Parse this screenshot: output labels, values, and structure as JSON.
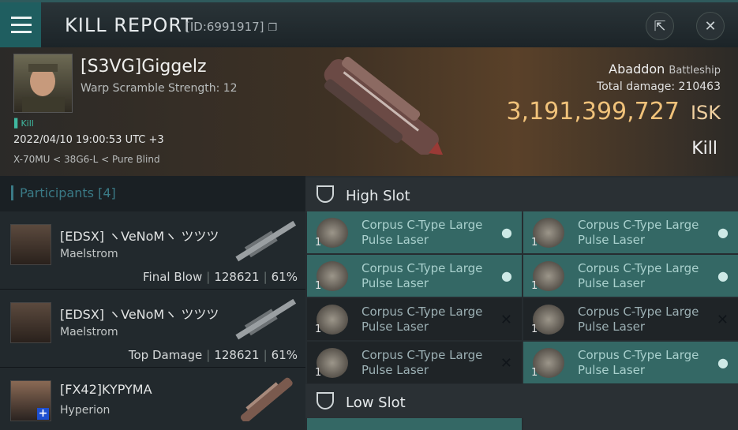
{
  "window": {
    "title": "KILL REPORT",
    "report_id": "[ID:6991917]"
  },
  "victim": {
    "name": "[S3VG]Giggelz",
    "warp_scramble": "Warp Scramble Strength: 12",
    "kill_tag": "Kill",
    "datetime": "2022/04/10 19:00:53 UTC +3",
    "location": "X-70MU < 38G6-L < Pure Blind",
    "ship_name": "Abaddon",
    "ship_class": "Battleship",
    "total_damage_label": "Total damage:",
    "total_damage": "210463",
    "isk_value": "3,191,399,727",
    "isk_unit": "ISK",
    "result": "Kill"
  },
  "participants": {
    "label": "Participants",
    "count": "[4]",
    "rows": [
      {
        "name": "[EDSX] ヽVeNoMヽ ツツツ",
        "ship": "Maelstrom",
        "role": "Final Blow",
        "damage": "128621",
        "percent": "61%"
      },
      {
        "name": "[EDSX] ヽVeNoMヽ ツツツ",
        "ship": "Maelstrom",
        "role": "Top Damage",
        "damage": "128621",
        "percent": "61%"
      },
      {
        "name": "[FX42]KYPYMA",
        "ship": "Hyperion",
        "role": "",
        "damage": "",
        "percent": ""
      }
    ]
  },
  "slots": {
    "high": {
      "label": "High Slot",
      "modules": [
        {
          "name": "Corpus C-Type Large Pulse Laser",
          "qty": "1",
          "status": "fitted"
        },
        {
          "name": "Corpus C-Type Large Pulse Laser",
          "qty": "1",
          "status": "fitted"
        },
        {
          "name": "Corpus C-Type Large Pulse Laser",
          "qty": "1",
          "status": "fitted"
        },
        {
          "name": "Corpus C-Type Large Pulse Laser",
          "qty": "1",
          "status": "fitted"
        },
        {
          "name": "Corpus C-Type Large Pulse Laser",
          "qty": "1",
          "status": "destroyed"
        },
        {
          "name": "Corpus C-Type Large Pulse Laser",
          "qty": "1",
          "status": "destroyed"
        },
        {
          "name": "Corpus C-Type Large Pulse Laser",
          "qty": "1",
          "status": "destroyed"
        },
        {
          "name": "Corpus C-Type Large Pulse Laser",
          "qty": "1",
          "status": "fitted"
        }
      ]
    },
    "low": {
      "label": "Low Slot"
    }
  },
  "icons": {
    "menu": "menu-icon",
    "id_copy": "copy-icon",
    "share": "share-icon",
    "close": "close-icon",
    "slot": "high-slot-icon",
    "dropped": "person-icon",
    "destroyed": "x-icon"
  },
  "colors": {
    "accent": "#1f5e60",
    "isk": "#f0c27a",
    "dropped_bg": "#346865",
    "destroyed_bg": "#1f2427"
  }
}
